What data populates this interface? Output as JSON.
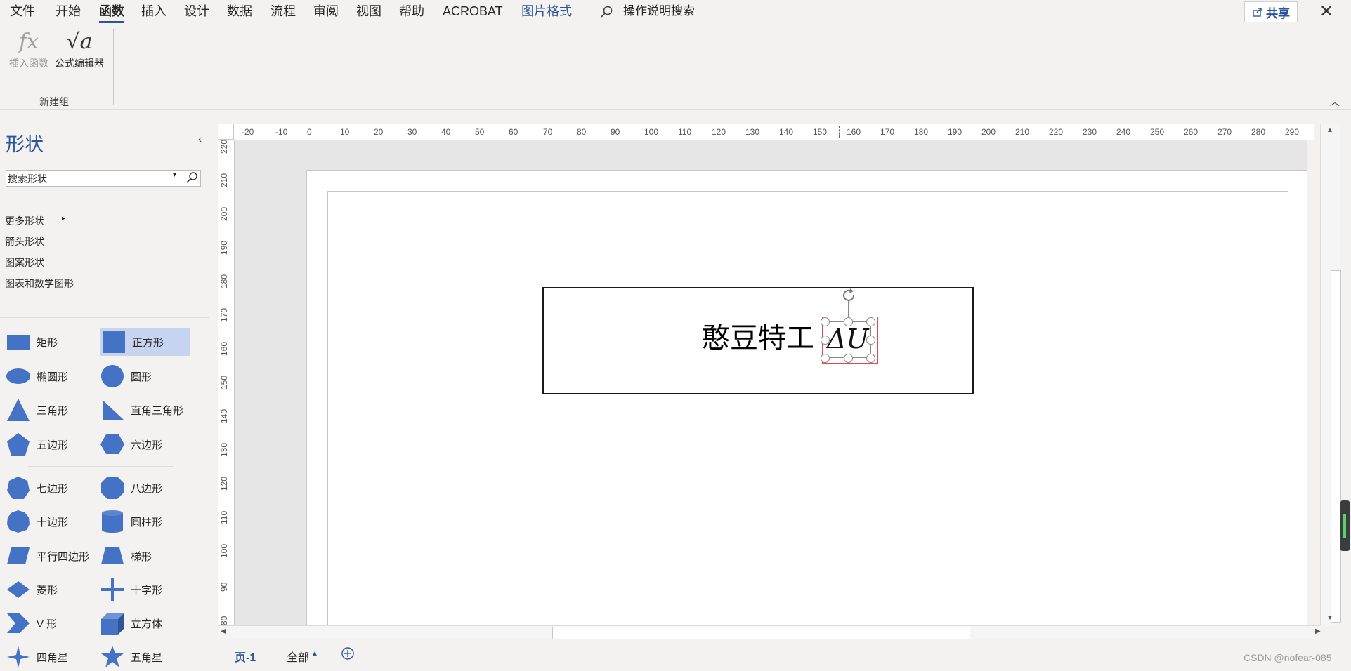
{
  "menu": {
    "items": [
      "文件",
      "开始",
      "函数",
      "插入",
      "设计",
      "数据",
      "流程",
      "审阅",
      "视图",
      "帮助",
      "ACROBAT"
    ],
    "context_tab": "图片格式",
    "search_placeholder": "操作说明搜索",
    "share_label": "共享"
  },
  "ribbon": {
    "insert_function_icon": "fx",
    "insert_function_label": "插入函数",
    "equation_editor_icon": "√a",
    "equation_editor_label": "公式编辑器",
    "group_label": "新建组"
  },
  "sidebar": {
    "title": "形状",
    "search_value": "搜索形状",
    "links": [
      "更多形状",
      "箭头形状",
      "图案形状",
      "图表和数学图形"
    ],
    "shapes": [
      "矩形",
      "正方形",
      "椭圆形",
      "圆形",
      "三角形",
      "直角三角形",
      "五边形",
      "六边形",
      "七边形",
      "八边形",
      "十边形",
      "圆柱形",
      "平行四边形",
      "梯形",
      "菱形",
      "十字形",
      "V 形",
      "立方体",
      "四角星",
      "五角星"
    ]
  },
  "ruler": {
    "h_ticks": [
      "-20",
      "-10",
      "0",
      "10",
      "20",
      "30",
      "40",
      "50",
      "60",
      "70",
      "80",
      "90",
      "100",
      "110",
      "120",
      "130",
      "140",
      "150",
      "160",
      "170",
      "180",
      "190",
      "200",
      "210",
      "220",
      "230",
      "240",
      "250",
      "260",
      "270",
      "280",
      "290",
      "30"
    ],
    "v_ticks": [
      "220",
      "210",
      "200",
      "190",
      "180",
      "170",
      "160",
      "150",
      "140",
      "130",
      "120",
      "110",
      "100",
      "90",
      "80"
    ]
  },
  "canvas": {
    "box_text": "憨豆特工",
    "formula_text": "ΔU"
  },
  "bottom": {
    "page_tab": "页-1",
    "all_tab": "全部",
    "watermark": "CSDN @nofear-085"
  },
  "colors": {
    "accent": "#2b579a",
    "shape_fill": "#4472c4",
    "selected_shape_bg": "#c7d4f0"
  }
}
